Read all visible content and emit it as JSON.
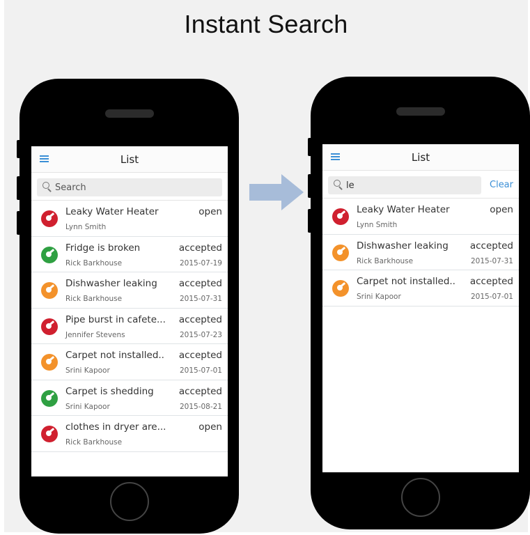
{
  "slide": {
    "title": "Instant Search"
  },
  "left_phone": {
    "header_title": "List",
    "search": {
      "placeholder": "Search",
      "value": ""
    },
    "items": [
      {
        "title": "Leaky Water Heater",
        "person": "Lynn Smith",
        "status": "open",
        "date": "",
        "color": "red"
      },
      {
        "title": "Fridge is broken",
        "person": "Rick Barkhouse",
        "status": "accepted",
        "date": "2015-07-19",
        "color": "green"
      },
      {
        "title": "Dishwasher leaking",
        "person": "Rick Barkhouse",
        "status": "accepted",
        "date": "2015-07-31",
        "color": "orange"
      },
      {
        "title": "Pipe burst in cafete...",
        "person": "Jennifer Stevens",
        "status": "accepted",
        "date": "2015-07-23",
        "color": "red"
      },
      {
        "title": "Carpet not installed..",
        "person": "Srini Kapoor",
        "status": "accepted",
        "date": "2015-07-01",
        "color": "orange"
      },
      {
        "title": "Carpet is shedding",
        "person": "Srini Kapoor",
        "status": "accepted",
        "date": "2015-08-21",
        "color": "green"
      },
      {
        "title": "clothes in dryer are...",
        "person": "Rick Barkhouse",
        "status": "open",
        "date": "",
        "color": "red"
      }
    ]
  },
  "right_phone": {
    "header_title": "List",
    "search": {
      "placeholder": "Search",
      "value": "le",
      "clear_label": "Clear"
    },
    "items": [
      {
        "title": "Leaky Water Heater",
        "person": "Lynn Smith",
        "status": "open",
        "date": "",
        "color": "red"
      },
      {
        "title": "Dishwasher leaking",
        "person": "Rick Barkhouse",
        "status": "accepted",
        "date": "2015-07-31",
        "color": "orange"
      },
      {
        "title": "Carpet not installed..",
        "person": "Srini Kapoor",
        "status": "accepted",
        "date": "2015-07-01",
        "color": "orange"
      }
    ]
  },
  "colors": {
    "red": "#d0202f",
    "green": "#2fa042",
    "orange": "#f3922b",
    "accent": "#3b8fd6",
    "arrow": "#a7bcd9"
  },
  "icons": {
    "menu": "hamburger-menu-icon",
    "search": "magnifier-icon",
    "status": "gauge-icon",
    "arrow": "right-arrow-icon"
  }
}
